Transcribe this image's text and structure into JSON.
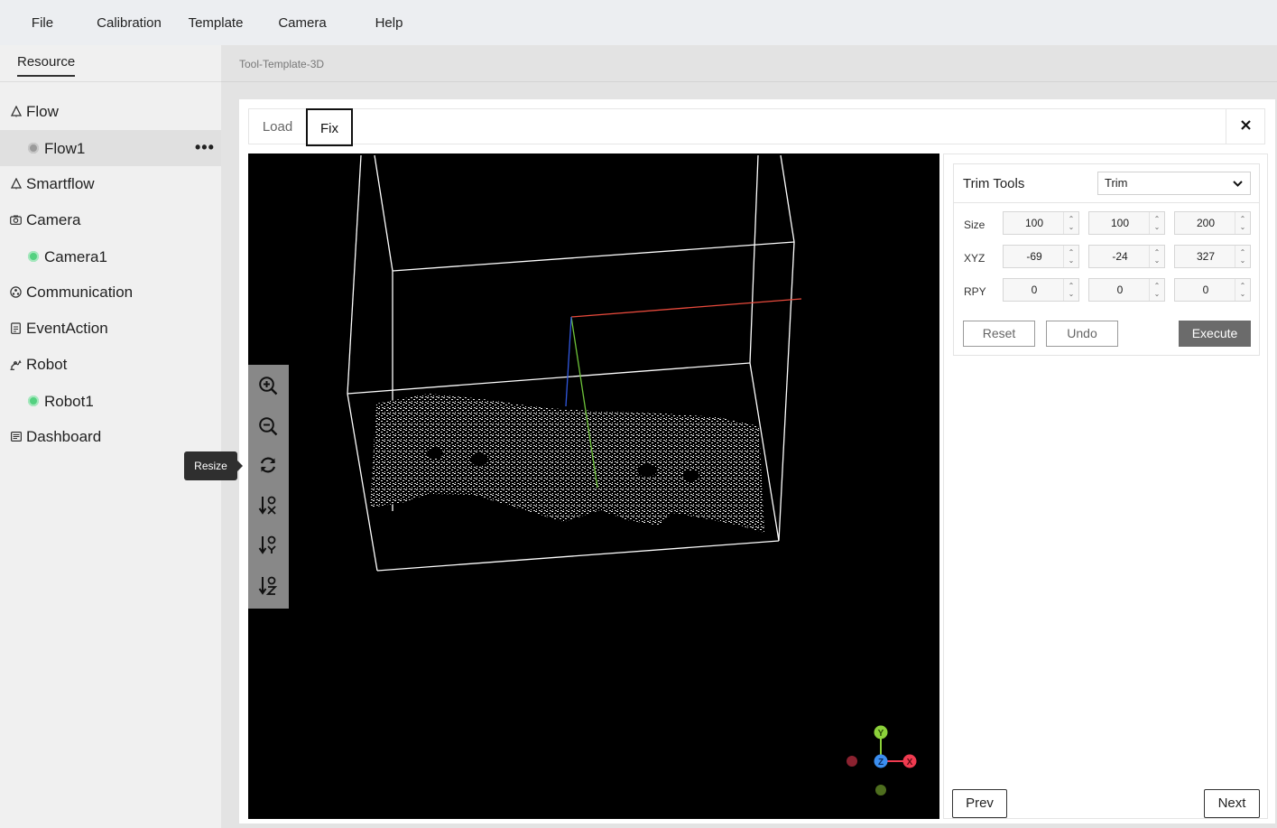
{
  "menu": {
    "items": [
      "File",
      "Calibration",
      "Template",
      "Camera",
      "Help"
    ]
  },
  "sidebar": {
    "tab_label": "Resource",
    "items": [
      {
        "label": "Flow",
        "icon": "flow-icon"
      },
      {
        "label": "Flow1",
        "status": "gray",
        "more": "•••"
      },
      {
        "label": "Smartflow",
        "icon": "smartflow-icon"
      },
      {
        "label": "Camera",
        "icon": "camera-icon"
      },
      {
        "label": "Camera1",
        "status": "green"
      },
      {
        "label": "Communication",
        "icon": "communication-icon"
      },
      {
        "label": "EventAction",
        "icon": "event-action-icon"
      },
      {
        "label": "Robot",
        "icon": "robot-icon"
      },
      {
        "label": "Robot1",
        "status": "green"
      },
      {
        "label": "Dashboard",
        "icon": "dashboard-icon"
      }
    ]
  },
  "tooltip": {
    "text": "Resize"
  },
  "main": {
    "breadcrumb": "Tool-Template-3D",
    "tabs": [
      {
        "label": "Load"
      },
      {
        "label": "Fix",
        "active": true
      }
    ],
    "close_label": "✕"
  },
  "viewer": {
    "tools": [
      "zoom-in-icon",
      "zoom-out-icon",
      "reset-view-icon",
      "view-x-icon",
      "view-y-icon",
      "view-z-icon"
    ],
    "axes": {
      "x": "X",
      "y": "Y",
      "z": "Z"
    }
  },
  "trim": {
    "title": "Trim Tools",
    "mode": "Trim",
    "rows": [
      {
        "label": "Size",
        "values": [
          "100",
          "100",
          "200"
        ]
      },
      {
        "label": "XYZ",
        "values": [
          "-69",
          "-24",
          "327"
        ]
      },
      {
        "label": "RPY",
        "values": [
          "0",
          "0",
          "0"
        ]
      }
    ],
    "reset_label": "Reset",
    "undo_label": "Undo",
    "execute_label": "Execute"
  },
  "nav": {
    "prev_label": "Prev",
    "next_label": "Next"
  },
  "colors": {
    "x_axis": "#f03b50",
    "y_axis": "#8cd13a",
    "z_axis": "#3b8ef0",
    "accent_dark": "#6b6b6b"
  }
}
